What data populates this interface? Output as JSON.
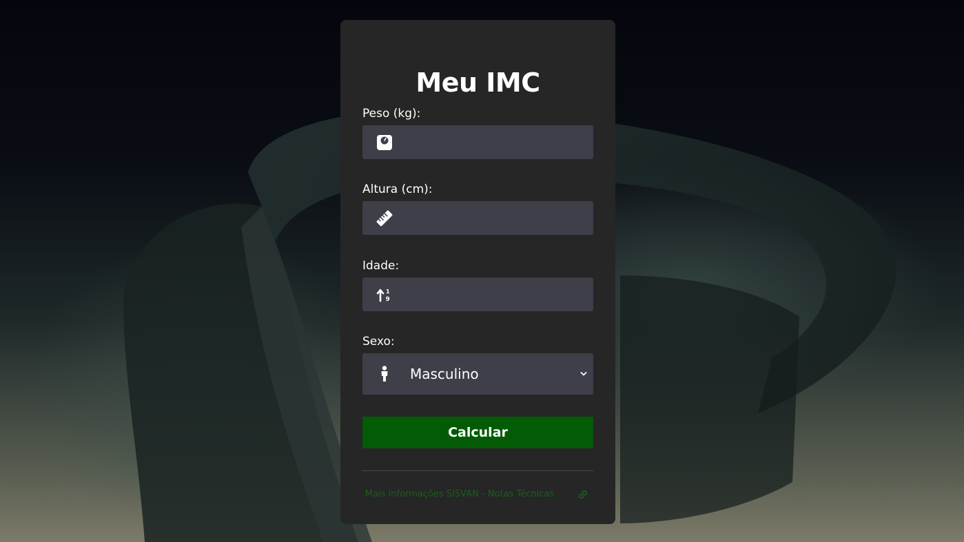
{
  "app": {
    "title": "Meu IMC"
  },
  "form": {
    "weight": {
      "label": "Peso (kg):",
      "value": "",
      "placeholder": "",
      "icon": "weight-scale-icon"
    },
    "height": {
      "label": "Altura (cm):",
      "value": "",
      "placeholder": "",
      "icon": "ruler-icon"
    },
    "age": {
      "label": "Idade:",
      "value": "",
      "placeholder": "",
      "icon": "sort-numeric-up-icon"
    },
    "sex": {
      "label": "Sexo:",
      "selected": "Masculino",
      "icon": "person-icon"
    },
    "submit_label": "Calcular"
  },
  "footer": {
    "link_text": "Mais informações SISVAN - Notas Técnicas",
    "icon": "link-icon"
  },
  "colors": {
    "card_background": "#262626",
    "input_background": "#3f3f4a",
    "button_background": "#045b05",
    "link_color": "#185f1a"
  }
}
